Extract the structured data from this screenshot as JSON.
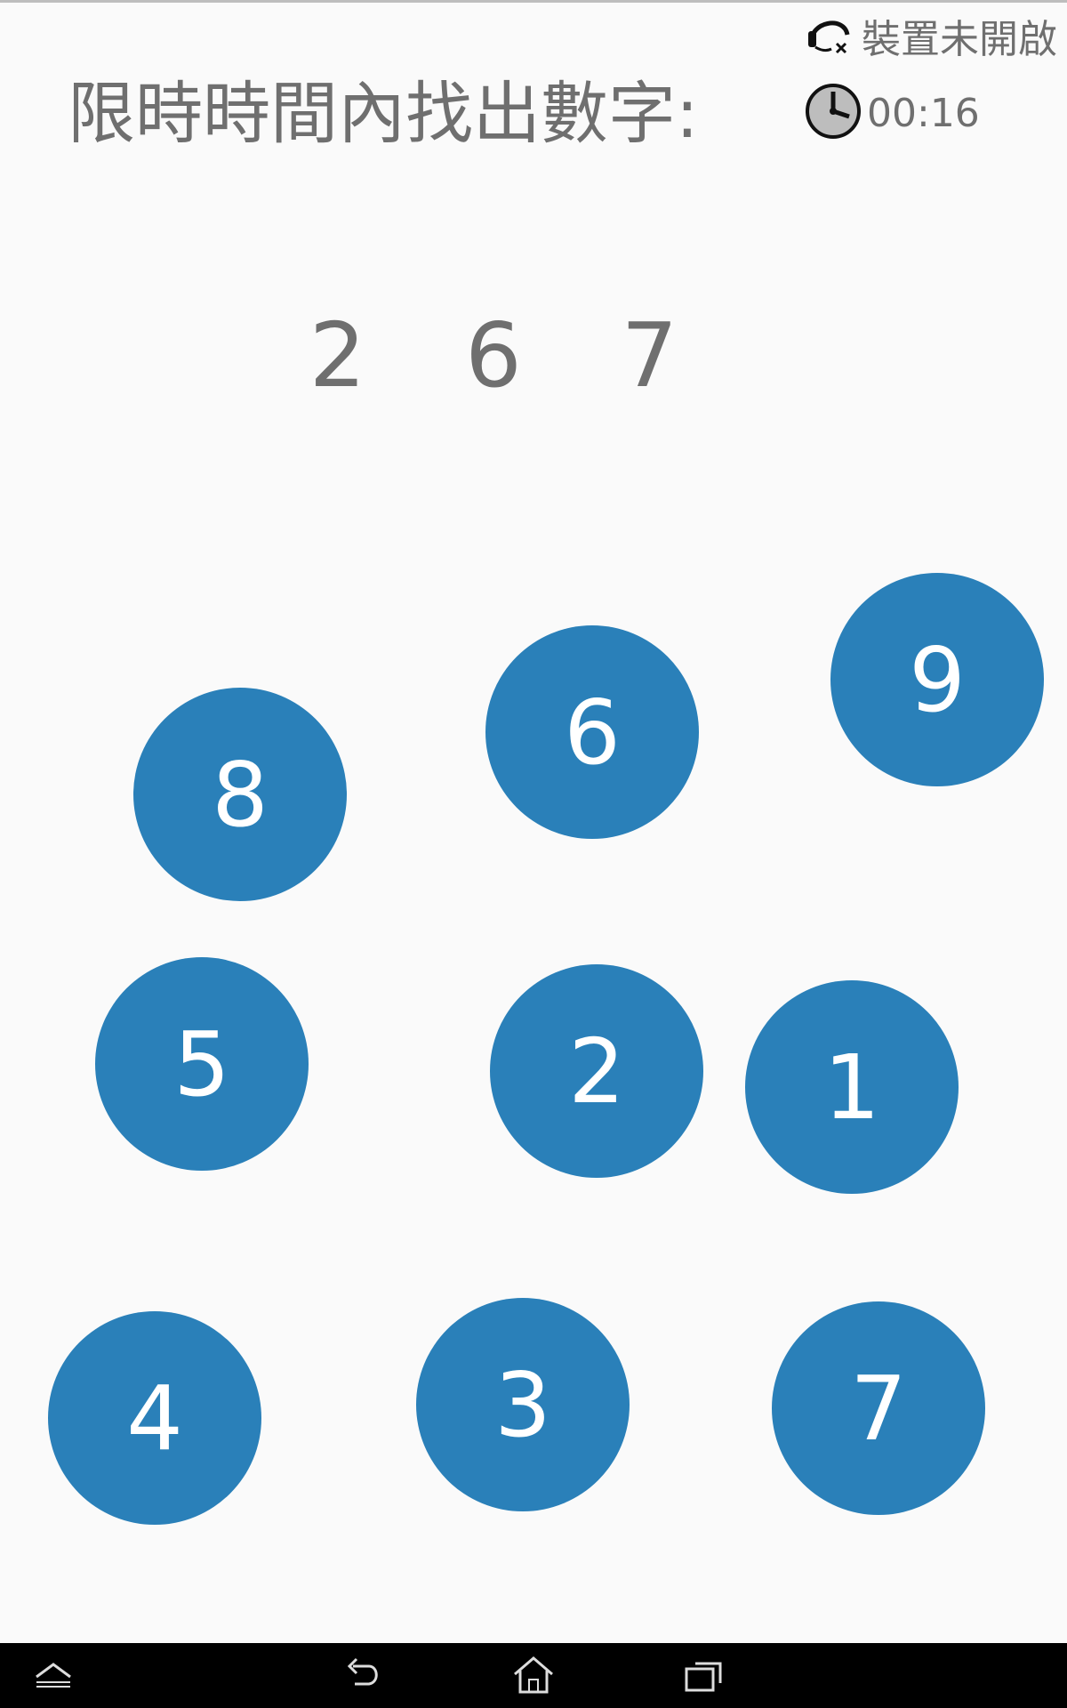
{
  "header": {
    "title": "限時時間內找出數字:",
    "device_status": "裝置未開啟",
    "device_icon": "headset-disconnected-icon",
    "timer": "00:16",
    "timer_icon": "clock-icon"
  },
  "targets": {
    "text": "2 6 7",
    "numbers": [
      "2",
      "6",
      "7"
    ]
  },
  "bubbles": [
    {
      "label": "8"
    },
    {
      "label": "6"
    },
    {
      "label": "9"
    },
    {
      "label": "5"
    },
    {
      "label": "2"
    },
    {
      "label": "1"
    },
    {
      "label": "4"
    },
    {
      "label": "3"
    },
    {
      "label": "7"
    }
  ],
  "navbar": {
    "buttons": [
      "recent-apps-up-icon",
      "back-icon",
      "home-icon",
      "recent-apps-icon"
    ]
  },
  "colors": {
    "bubble": "#2a80b9",
    "text": "#6f6f6f",
    "background": "#fafafa",
    "navbar": "#000000"
  }
}
